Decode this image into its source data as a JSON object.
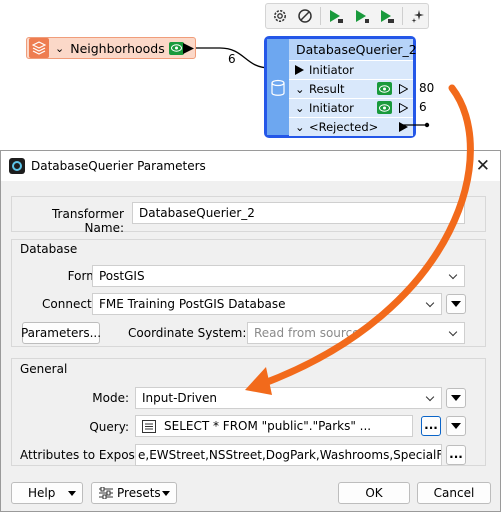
{
  "canvas": {
    "toolbar_icons": [
      "gear-icon",
      "disable-icon",
      "run-to-this-icon",
      "run-from-this-icon",
      "run-between-icon",
      "quick-add-icon"
    ],
    "reader": {
      "label": "Neighborhoods",
      "icon": "layers-icon"
    },
    "connection_count_in": "6",
    "transformer": {
      "title": "DatabaseQuerier_2",
      "input_port": "Initiator",
      "ports": [
        {
          "label": "Result",
          "count": "80"
        },
        {
          "label": "Initiator",
          "count": "6"
        },
        {
          "label": "<Rejected>",
          "count": ""
        }
      ]
    },
    "colors": {
      "accent_arrow": "#f26a1b",
      "transformer_border": "#2457e8",
      "reader_fill": "#fbd8c8"
    }
  },
  "dialog": {
    "title": "DatabaseQuerier Parameters",
    "transformer_name": {
      "label": "Transformer Name:",
      "value": "DatabaseQuerier_2"
    },
    "database": {
      "group_label": "Database",
      "format_label": "Format:",
      "format_value": "PostGIS",
      "connection_label": "Connection:",
      "connection_value": "FME Training PostGIS Database",
      "parameters_button": "Parameters...",
      "coord_label": "Coordinate System:",
      "coord_placeholder": "Read from source"
    },
    "general": {
      "group_label": "General",
      "mode_label": "Mode:",
      "mode_value": "Input-Driven",
      "query_label": "Query:",
      "query_value": "SELECT * FROM \"public\".\"Parks\" ...",
      "attrs_label": "Attributes to Expose:",
      "attrs_value": "e,EWStreet,NSStreet,DogPark,Washrooms,SpecialFeatures",
      "ellipsis": "..."
    },
    "footer": {
      "help": "Help",
      "presets": "Presets",
      "ok": "OK",
      "cancel": "Cancel"
    }
  }
}
